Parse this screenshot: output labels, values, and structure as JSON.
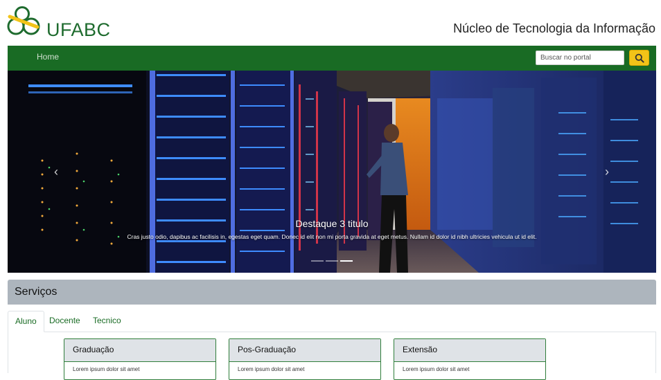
{
  "brand": {
    "logo_text": "UFABC",
    "site_title": "Núcleo de Tecnologia da Informação",
    "logo_color": "#1e6b2e",
    "logo_accent": "#f2c318"
  },
  "nav": {
    "home_label": "Home",
    "search_placeholder": "Buscar no portal",
    "bar_color": "#196b24",
    "search_button_color": "#f2c318"
  },
  "carousel": {
    "caption_title": "Destaque 3 titulo",
    "caption_text": "Cras justo odio, dapibus ac facilisis in, egestas eget quam. Donec id elit non mi porta gravida at eget metus. Nullam id dolor id nibh ultricies vehicula ut id elit.",
    "prev_icon": "chevron-left-icon",
    "next_icon": "chevron-right-icon",
    "prev_glyph": "‹",
    "next_glyph": "›",
    "slide_count": 3,
    "active_slide": 3
  },
  "services": {
    "title": "Serviços",
    "tabs": [
      {
        "label": "Aluno",
        "active": true
      },
      {
        "label": "Docente",
        "active": false
      },
      {
        "label": "Tecnico",
        "active": false
      }
    ],
    "cards": [
      {
        "title": "Graduação",
        "body": "Lorem ipsum dolor sit amet"
      },
      {
        "title": "Pos-Graduação",
        "body": "Lorem ipsum dolor sit amet"
      },
      {
        "title": "Extensão",
        "body": "Lorem ipsum dolor sit amet"
      }
    ]
  }
}
